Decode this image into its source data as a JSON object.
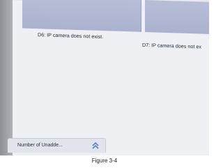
{
  "cameras": [
    {
      "id": "D6",
      "message": "D6: IP camera does not exist."
    },
    {
      "id": "D7",
      "message": "D7: IP camera does not ex"
    }
  ],
  "status_bar": {
    "text": "Number of Unadde...",
    "expand_icon": "double-chevron-up-icon"
  },
  "caption": "Figure 3-4",
  "colors": {
    "tile": "#b7bed6",
    "screen": "#eef0f3",
    "text": "#1f2733",
    "chevron": "#5b7fcf"
  }
}
